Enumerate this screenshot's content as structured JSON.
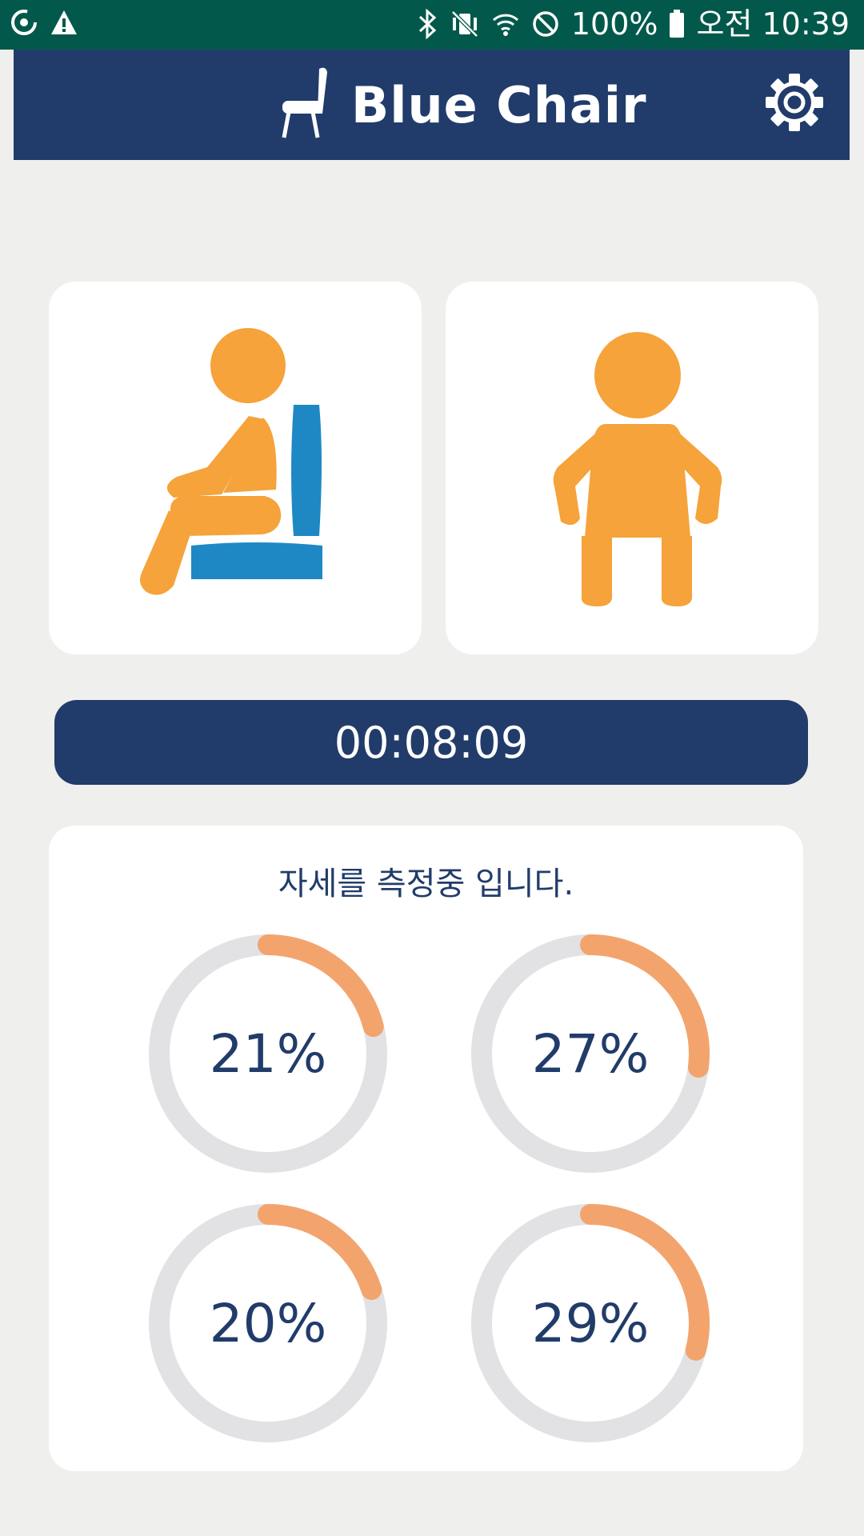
{
  "status_bar": {
    "left_icons": [
      "sync-icon",
      "warning-icon"
    ],
    "right_icons": [
      "bluetooth-icon",
      "vibrate-mute-icon",
      "wifi-icon",
      "do-not-disturb-icon",
      "battery-icon"
    ],
    "battery": "100%",
    "time": "오전 10:39"
  },
  "header": {
    "title": "Blue Chair",
    "logo_icon": "chair-icon",
    "settings_icon": "gear-icon"
  },
  "posture_cards": [
    {
      "name": "side-view",
      "icon": "seated-side-posture-icon"
    },
    {
      "name": "front-view",
      "icon": "seated-front-posture-icon"
    }
  ],
  "timer": {
    "value": "00:08:09"
  },
  "measurement": {
    "message": "자세를 측정중 입니다.",
    "gauges": [
      {
        "label": "21%",
        "value": 21
      },
      {
        "label": "27%",
        "value": 27
      },
      {
        "label": "20%",
        "value": 20
      },
      {
        "label": "29%",
        "value": 29
      }
    ]
  },
  "colors": {
    "header_bg": "#213c6a",
    "statusbar_bg": "#02594b",
    "figure_orange": "#f5a33a",
    "chair_blue": "#1e88c4",
    "gauge_fill": "#f3a46d",
    "gauge_track": "#e2e2e4",
    "page_bg": "#efefee"
  }
}
